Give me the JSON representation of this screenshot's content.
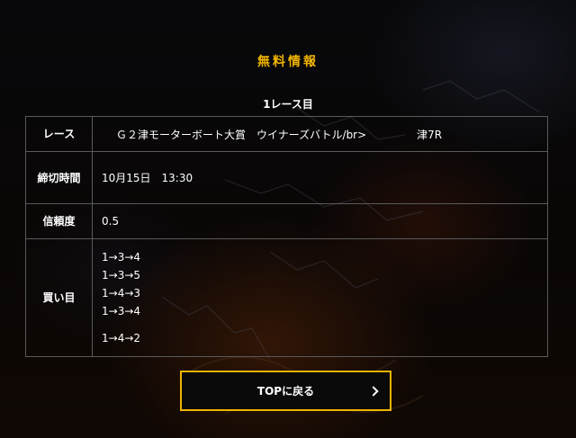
{
  "section_title": "無料情報",
  "race_heading": "1レース目",
  "table": {
    "race": {
      "label": "レース",
      "name": "Ｇ２津モーターボート大賞　ウイナーズバトル/br>",
      "number": "津7R"
    },
    "deadline": {
      "label": "締切時間",
      "value": "10月15日　13:30"
    },
    "confidence": {
      "label": "信頼度",
      "value": "0.5"
    },
    "bets": {
      "label": "買い目",
      "items": [
        "1→3→4",
        "1→3→5",
        "1→4→3",
        "1→3→4",
        "1→4→2"
      ]
    }
  },
  "top_button": {
    "label": "TOPに戻る",
    "icon": "chevron-right-icon"
  },
  "colors": {
    "accent": "#f0b400",
    "border": "#5a5a5a"
  }
}
